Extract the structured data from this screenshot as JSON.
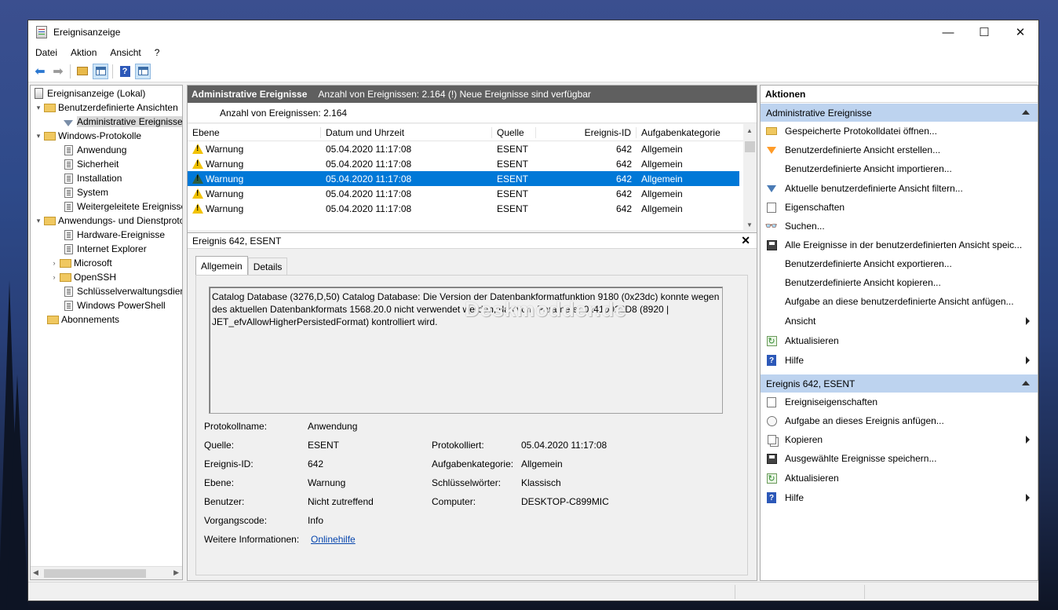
{
  "window": {
    "title": "Ereignisanzeige",
    "controls": [
      "—",
      "☐",
      "✕"
    ]
  },
  "menu": [
    "Datei",
    "Aktion",
    "Ansicht",
    "?"
  ],
  "tree": {
    "root": "Ereignisanzeige (Lokal)",
    "custom_views": "Benutzerdefinierte Ansichten",
    "admin_events": "Administrative Ereignisse",
    "windows_logs": "Windows-Protokolle",
    "logs": [
      "Anwendung",
      "Sicherheit",
      "Installation",
      "System",
      "Weitergeleitete Ereignisse"
    ],
    "apps_services": "Anwendungs- und Dienstprotokolle",
    "app_items": [
      "Hardware-Ereignisse",
      "Internet Explorer",
      "Microsoft",
      "OpenSSH",
      "Schlüsselverwaltungsdienst",
      "Windows PowerShell"
    ],
    "subscriptions": "Abonnements"
  },
  "middle": {
    "header_title": "Administrative Ereignisse",
    "header_info": "Anzahl von Ereignissen: 2.164 (!) Neue Ereignisse sind verfügbar",
    "filter_text": "Anzahl von Ereignissen: 2.164",
    "columns": [
      "Ebene",
      "Datum und Uhrzeit",
      "Quelle",
      "Ereignis-ID",
      "Aufgabenkategorie"
    ],
    "rows": [
      {
        "level": "Warnung",
        "date": "05.04.2020 11:17:08",
        "source": "ESENT",
        "id": "642",
        "category": "Allgemein"
      },
      {
        "level": "Warnung",
        "date": "05.04.2020 11:17:08",
        "source": "ESENT",
        "id": "642",
        "category": "Allgemein"
      },
      {
        "level": "Warnung",
        "date": "05.04.2020 11:17:08",
        "source": "ESENT",
        "id": "642",
        "category": "Allgemein"
      },
      {
        "level": "Warnung",
        "date": "05.04.2020 11:17:08",
        "source": "ESENT",
        "id": "642",
        "category": "Allgemein"
      },
      {
        "level": "Warnung",
        "date": "05.04.2020 11:17:08",
        "source": "ESENT",
        "id": "642",
        "category": "Allgemein"
      }
    ]
  },
  "detail": {
    "title": "Ereignis 642, ESENT",
    "tabs": [
      "Allgemein",
      "Details"
    ],
    "message": "Catalog Database (3276,D,50) Catalog Database: Die Version der Datenbankformatfunktion 9180 (0x23dc) konnte wegen des aktuellen Datenbankformats 1568.20.0 nicht verwendet werden, das vom Parameter 0x410022D8 (8920 | JET_efvAllowHigherPersistedFormat) kontrolliert wird.",
    "watermark": "Deskmodder.de",
    "labels": {
      "log_name": "Protokollname:",
      "source": "Quelle:",
      "event_id": "Ereignis-ID:",
      "level": "Ebene:",
      "user": "Benutzer:",
      "opcode": "Vorgangscode:",
      "more_info": "Weitere Informationen:",
      "logged": "Protokolliert:",
      "task_category": "Aufgabenkategorie:",
      "keywords": "Schlüsselwörter:",
      "computer": "Computer:"
    },
    "values": {
      "log_name": "Anwendung",
      "source": "ESENT",
      "event_id": "642",
      "level": "Warnung",
      "user": "Nicht zutreffend",
      "opcode": "Info",
      "more_info": "Onlinehilfe",
      "logged": "05.04.2020 11:17:08",
      "task_category": "Allgemein",
      "keywords": "Klassisch",
      "computer": "DESKTOP-C899MIC"
    }
  },
  "actions": {
    "header": "Aktionen",
    "section1": "Administrative Ereignisse",
    "items1": [
      "Gespeicherte Protokolldatei öffnen...",
      "Benutzerdefinierte Ansicht erstellen...",
      "Benutzerdefinierte Ansicht importieren...",
      "Aktuelle benutzerdefinierte Ansicht filtern...",
      "Eigenschaften",
      "Suchen...",
      "Alle Ereignisse in der benutzerdefinierten Ansicht speic...",
      "Benutzerdefinierte Ansicht exportieren...",
      "Benutzerdefinierte Ansicht kopieren...",
      "Aufgabe an diese benutzerdefinierte Ansicht anfügen...",
      "Ansicht",
      "Aktualisieren",
      "Hilfe"
    ],
    "section2": "Ereignis 642, ESENT",
    "items2": [
      "Ereigniseigenschaften",
      "Aufgabe an dieses Ereignis anfügen...",
      "Kopieren",
      "Ausgewählte Ereignisse speichern...",
      "Aktualisieren",
      "Hilfe"
    ]
  },
  "colors": {
    "selection": "#0078d7",
    "section_header": "#bdd3ef",
    "middle_header": "#5f5f5f"
  }
}
